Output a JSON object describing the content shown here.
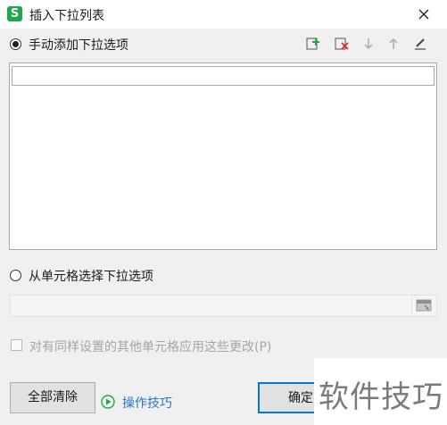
{
  "window": {
    "app_icon_letter": "S",
    "title": "插入下拉列表",
    "close_glyph": "✕"
  },
  "manual_option": {
    "label": "手动添加下拉选项",
    "selected": true
  },
  "toolbar": {
    "icons": [
      "add-item-icon",
      "delete-item-icon",
      "move-down-icon",
      "move-up-icon",
      "edit-icon"
    ],
    "add_color": "#1ea84a",
    "delete_color": "#d9302b"
  },
  "list": {
    "edit_value": "",
    "items": []
  },
  "range_option": {
    "label": "从单元格选择下拉选项",
    "selected": false
  },
  "range_input": {
    "value": ""
  },
  "apply_checkbox": {
    "label": "对有同样设置的其他单元格应用这些更改(P)",
    "checked": false,
    "enabled": false
  },
  "buttons": {
    "clear_all": "全部清除",
    "tips": "操作技巧",
    "ok": "确定"
  },
  "watermark": {
    "text": "软件技巧"
  },
  "colors": {
    "accent": "#0078d7",
    "link": "#2c74c4",
    "brand": "#1ea84a"
  }
}
